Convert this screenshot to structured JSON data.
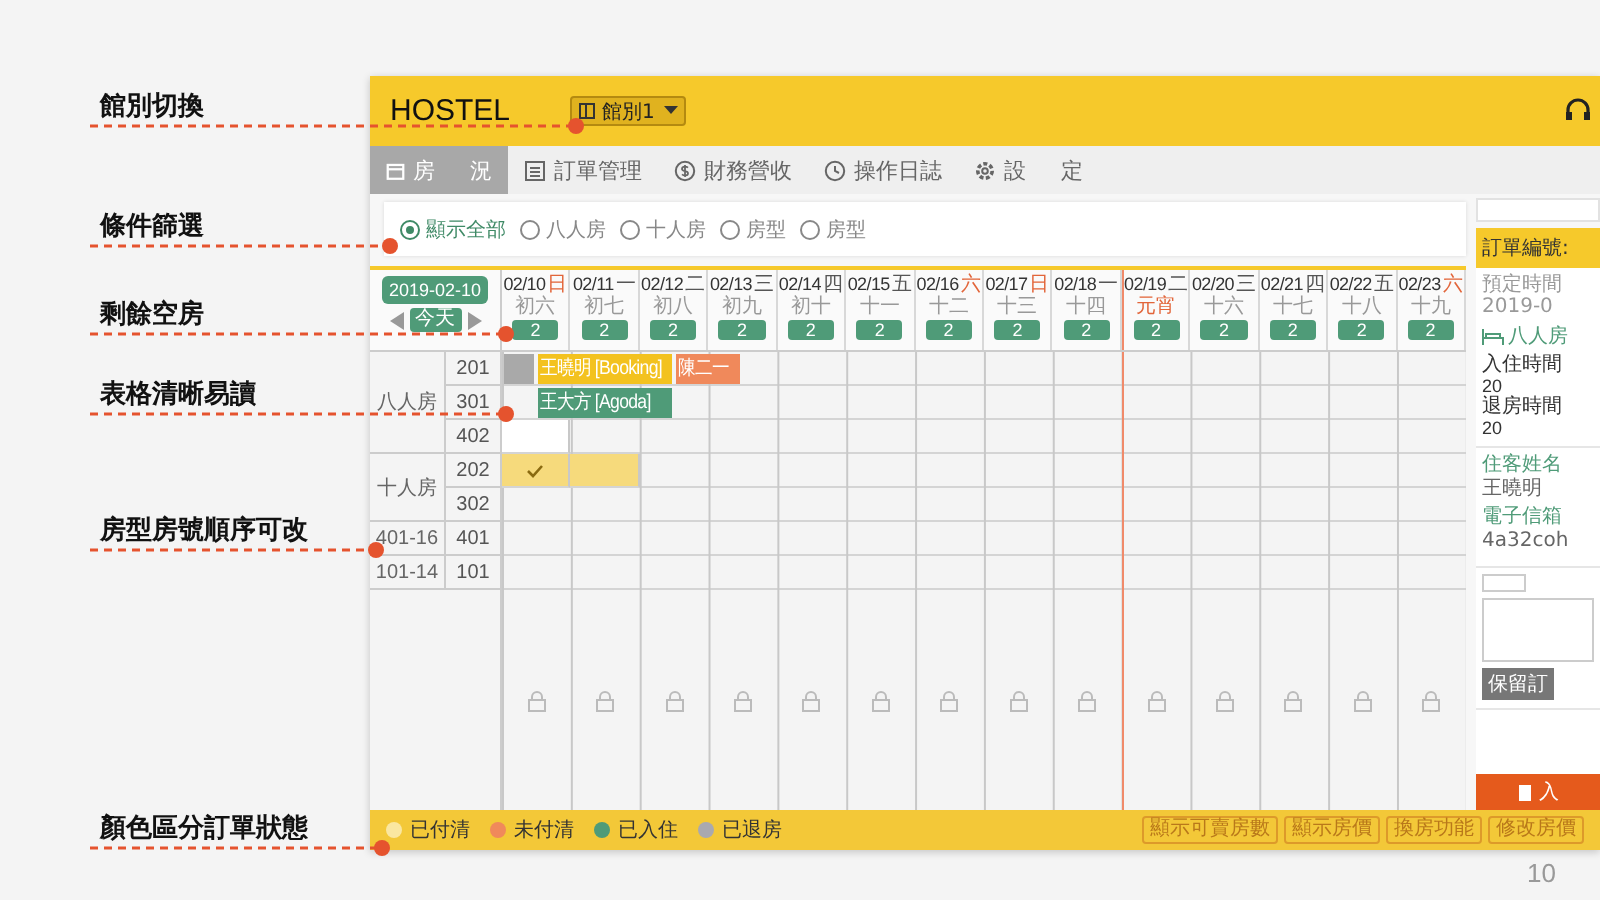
{
  "annotations": [
    "館別切換",
    "條件篩選",
    "剩餘空房",
    "表格清晰易讀",
    "房型房號順序可改",
    "顏色區分訂單狀態"
  ],
  "app": {
    "brand": "HOSTEL",
    "branch_select": {
      "value": "館別1"
    },
    "tabs": [
      {
        "label": "房 況",
        "selected": true
      },
      {
        "label": "訂單管理",
        "selected": false
      },
      {
        "label": "財務營收",
        "selected": false
      },
      {
        "label": "操作日誌",
        "selected": false
      },
      {
        "label": "設 定",
        "selected": false
      }
    ],
    "filters": [
      {
        "label": "顯示全部",
        "selected": true
      },
      {
        "label": "八人房",
        "selected": false
      },
      {
        "label": "十人房",
        "selected": false
      },
      {
        "label": "房型",
        "selected": false
      },
      {
        "label": "房型",
        "selected": false
      }
    ],
    "calendar": {
      "date": "2019-02-10",
      "today_button": "今天",
      "days": [
        {
          "date": "02/10",
          "weekday": "日",
          "weekend": true,
          "lunar": "初六",
          "holiday": false,
          "available": "2"
        },
        {
          "date": "02/11",
          "weekday": "一",
          "weekend": false,
          "lunar": "初七",
          "holiday": false,
          "available": "2"
        },
        {
          "date": "02/12",
          "weekday": "二",
          "weekend": false,
          "lunar": "初八",
          "holiday": false,
          "available": "2"
        },
        {
          "date": "02/13",
          "weekday": "三",
          "weekend": false,
          "lunar": "初九",
          "holiday": false,
          "available": "2"
        },
        {
          "date": "02/14",
          "weekday": "四",
          "weekend": false,
          "lunar": "初十",
          "holiday": false,
          "available": "2"
        },
        {
          "date": "02/15",
          "weekday": "五",
          "weekend": false,
          "lunar": "十一",
          "holiday": false,
          "available": "2"
        },
        {
          "date": "02/16",
          "weekday": "六",
          "weekend": true,
          "lunar": "十二",
          "holiday": false,
          "available": "2"
        },
        {
          "date": "02/17",
          "weekday": "日",
          "weekend": true,
          "lunar": "十三",
          "holiday": false,
          "available": "2"
        },
        {
          "date": "02/18",
          "weekday": "一",
          "weekend": false,
          "lunar": "十四",
          "holiday": false,
          "available": "2"
        },
        {
          "date": "02/19",
          "weekday": "二",
          "weekend": false,
          "lunar": "元宵",
          "holiday": true,
          "available": "2"
        },
        {
          "date": "02/20",
          "weekday": "三",
          "weekend": false,
          "lunar": "十六",
          "holiday": false,
          "available": "2"
        },
        {
          "date": "02/21",
          "weekday": "四",
          "weekend": false,
          "lunar": "十七",
          "holiday": false,
          "available": "2"
        },
        {
          "date": "02/22",
          "weekday": "五",
          "weekend": false,
          "lunar": "十八",
          "holiday": false,
          "available": "2"
        },
        {
          "date": "02/23",
          "weekday": "六",
          "weekend": true,
          "lunar": "十九",
          "holiday": false,
          "available": "2"
        }
      ],
      "room_types": [
        {
          "name": "八人房",
          "rooms": [
            {
              "number": "201",
              "cells": [
                {
                  "out": {
                    "kind": "checked-out"
                  },
                  "in": {
                    "kind": "paid",
                    "label": "王曉明 [Booking]"
                  }
                },
                {},
                {
                  "out": {
                    "kind": "paid"
                  },
                  "in": {
                    "kind": "unpaid",
                    "label": "陳二一"
                  }
                },
                {
                  "out": {
                    "kind": "unpaid"
                  }
                },
                {},
                {},
                {},
                {},
                {},
                {},
                {},
                {},
                {},
                {}
              ]
            },
            {
              "number": "301",
              "cells": [
                {
                  "in": {
                    "kind": "checked-in",
                    "label": "王大方 [Agoda]"
                  }
                },
                {},
                {
                  "out": {
                    "kind": "checked-in"
                  }
                },
                {},
                {},
                {},
                {},
                {},
                {},
                {},
                {},
                {},
                {},
                {}
              ]
            },
            {
              "number": "402",
              "cells": [
                {
                  "highlighted": true
                },
                {},
                {},
                {},
                {},
                {},
                {},
                {},
                {},
                {},
                {},
                {},
                {},
                {}
              ]
            }
          ]
        },
        {
          "name": "十人房",
          "rooms": [
            {
              "number": "202",
              "cells": [
                {
                  "selected": true,
                  "checked": true
                },
                {
                  "selected": true
                },
                {},
                {},
                {},
                {},
                {},
                {},
                {},
                {},
                {},
                {},
                {},
                {}
              ]
            },
            {
              "number": "302",
              "cells": [
                {},
                {},
                {},
                {},
                {},
                {},
                {},
                {},
                {},
                {},
                {},
                {},
                {},
                {}
              ]
            }
          ]
        },
        {
          "name": "401-16",
          "rooms": [
            {
              "number": "401",
              "cells": [
                {},
                {},
                {},
                {},
                {},
                {},
                {},
                {},
                {},
                {},
                {},
                {},
                {},
                {}
              ]
            }
          ]
        },
        {
          "name": "101-14",
          "rooms": [
            {
              "number": "101",
              "cells": [
                {},
                {},
                {},
                {},
                {},
                {},
                {},
                {},
                {},
                {},
                {},
                {},
                {},
                {}
              ]
            }
          ]
        }
      ]
    },
    "legend": [
      {
        "label": "已付清",
        "color": "#fae7a0"
      },
      {
        "label": "未付清",
        "color": "#f0895b"
      },
      {
        "label": "已入住",
        "color": "#4f9b78"
      },
      {
        "label": "已退房",
        "color": "#a9a9b0"
      }
    ],
    "footer_buttons": [
      "顯示可賣房數",
      "顯示房價",
      "換房功能",
      "修改房價"
    ],
    "order_panel": {
      "title": "訂單編號:",
      "booked_label": "預定時間",
      "booked_value": "2019-0",
      "room_type": "八人房",
      "check_in_label": "入住時間",
      "check_in_value": "20",
      "check_out_label": "退房時間",
      "check_out_value": "20",
      "guest_label": "住客姓名",
      "guest_name": "王曉明",
      "email_label": "電子信箱",
      "email": "4a32coh",
      "hold_button": "保留訂",
      "checkin_button": "入"
    }
  },
  "page_number": "10"
}
